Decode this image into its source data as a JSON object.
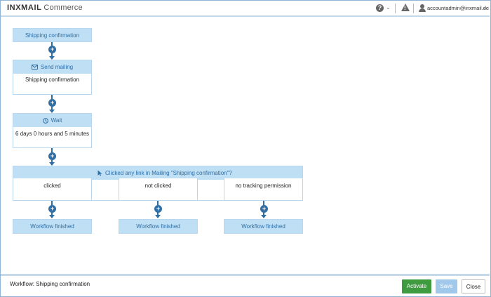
{
  "header": {
    "logo_brand": "INXMAIL",
    "logo_product": "Commerce",
    "help_icon": "question-circle-icon",
    "warning_icon": "warning-triangle-icon",
    "user_icon": "user-icon",
    "account_name": "accountadmin@inxmail.de"
  },
  "workflow": {
    "trigger": {
      "label": "Shipping confirmation"
    },
    "send_mailing": {
      "title": "Send mailing",
      "icon": "envelope-icon",
      "body": "Shipping confirmation"
    },
    "wait": {
      "title": "Wait",
      "icon": "clock-icon",
      "body": "6 days 0 hours and 5 minutes"
    },
    "condition": {
      "title": "Clicked any link in Mailing \"Shipping confirmation\"?",
      "icon": "cursor-icon"
    },
    "branches": [
      {
        "label": "clicked",
        "end": "Workflow finished"
      },
      {
        "label": "not clicked",
        "end": "Workflow finished"
      },
      {
        "label": "no tracking permission",
        "end": "Workflow finished"
      }
    ],
    "add_icon": "plus-circle-icon"
  },
  "footer": {
    "workflow_name": "Workflow: Shipping confirmation",
    "activate_label": "Activate",
    "save_label": "Save",
    "close_label": "Close"
  },
  "colors": {
    "accent": "#2f6fa6",
    "node_header": "#bfdff4",
    "activate": "#3f9b3f",
    "save_disabled": "#9fc8ea"
  }
}
